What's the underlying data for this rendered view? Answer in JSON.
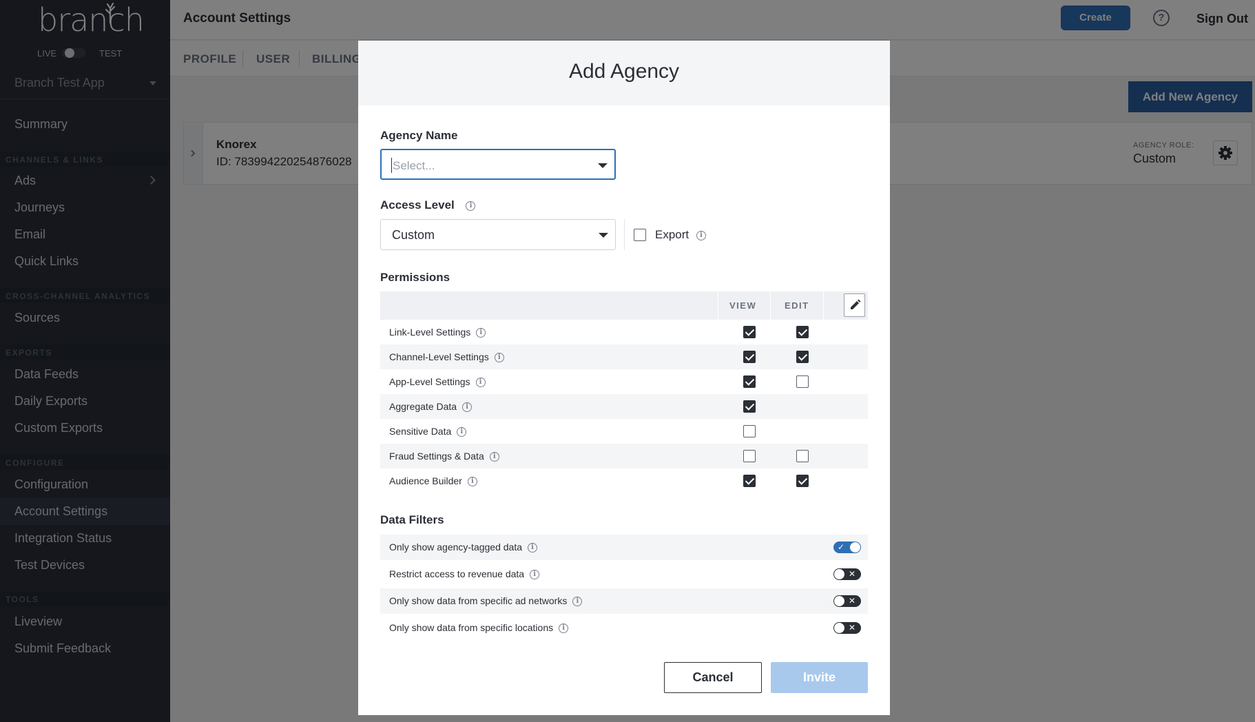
{
  "sidebar": {
    "logo": "branch",
    "env_live": "LIVE",
    "env_test": "TEST",
    "app_name": "Branch Test App",
    "summary": "Summary",
    "sections": {
      "channels": "CHANNELS & LINKS",
      "analytics": "CROSS-CHANNEL ANALYTICS",
      "exports": "EXPORTS",
      "configure": "CONFIGURE",
      "tools": "TOOLS"
    },
    "items": {
      "ads": "Ads",
      "journeys": "Journeys",
      "email": "Email",
      "quick_links": "Quick Links",
      "sources": "Sources",
      "data_feeds": "Data Feeds",
      "daily_exports": "Daily Exports",
      "custom_exports": "Custom Exports",
      "configuration": "Configuration",
      "account_settings": "Account Settings",
      "integration_status": "Integration Status",
      "test_devices": "Test Devices",
      "liveview": "Liveview",
      "submit_feedback": "Submit Feedback"
    }
  },
  "header": {
    "title": "Account Settings",
    "create": "Create",
    "help": "?",
    "sign_out": "Sign Out"
  },
  "tabs": [
    "PROFILE",
    "USER",
    "BILLING"
  ],
  "page": {
    "add_new_agency": "Add New Agency",
    "agency_name": "Knorex",
    "agency_id": "ID: 783994220254876028",
    "agency_role_label": "AGENCY ROLE:",
    "agency_role_value": "Custom"
  },
  "modal": {
    "title": "Add Agency",
    "agency_name_label": "Agency Name",
    "agency_name_placeholder": "Select...",
    "access_level_label": "Access Level",
    "access_level_value": "Custom",
    "export_label": "Export",
    "export_checked": false,
    "permissions_label": "Permissions",
    "col_view": "VIEW",
    "col_edit": "EDIT",
    "permissions": [
      {
        "name": "Link-Level Settings",
        "view": true,
        "edit": true
      },
      {
        "name": "Channel-Level Settings",
        "view": true,
        "edit": true
      },
      {
        "name": "App-Level Settings",
        "view": true,
        "edit": false
      },
      {
        "name": "Aggregate Data",
        "view": true,
        "edit": null
      },
      {
        "name": "Sensitive Data",
        "view": false,
        "edit": null
      },
      {
        "name": "Fraud Settings & Data",
        "view": false,
        "edit": false
      },
      {
        "name": "Audience Builder",
        "view": true,
        "edit": true
      }
    ],
    "data_filters_label": "Data Filters",
    "filters": [
      {
        "name": "Only show agency-tagged data",
        "on": true
      },
      {
        "name": "Restrict access to revenue data",
        "on": false
      },
      {
        "name": "Only show data from specific ad networks",
        "on": false
      },
      {
        "name": "Only show data from specific locations",
        "on": false
      }
    ],
    "cancel": "Cancel",
    "invite": "Invite"
  },
  "colors": {
    "accent": "#2f6fb6",
    "sidebar_bg": "#2a2f3a",
    "invite_disabled": "#a9c9ec"
  }
}
